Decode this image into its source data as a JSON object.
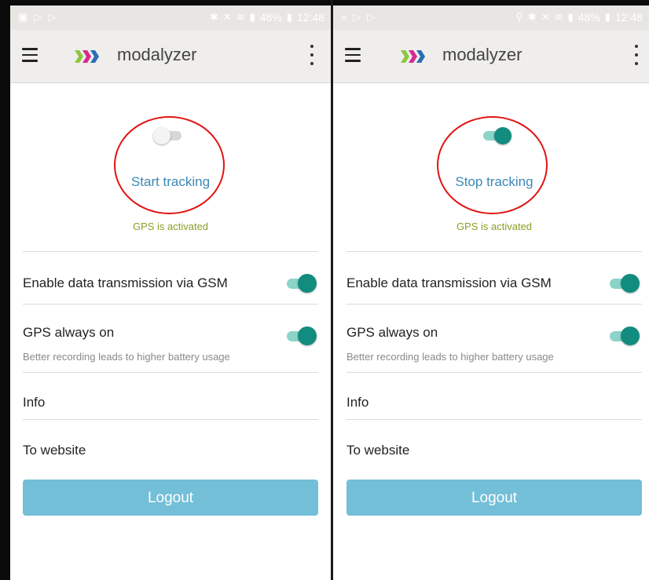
{
  "statusbar": {
    "battery": "48%",
    "time": "12:48"
  },
  "app": {
    "title": "modalyzer"
  },
  "left": {
    "track_button": "Start tracking",
    "gps_status": "GPS is activated",
    "tracking_enabled": false,
    "settings": [
      {
        "label": "Enable data transmission via GSM",
        "enabled": true
      },
      {
        "label": "GPS always on",
        "sub": "Better recording leads to higher battery usage",
        "enabled": true
      }
    ],
    "links": [
      "Info",
      "To website"
    ],
    "logout": "Logout"
  },
  "right": {
    "track_button": "Stop tracking",
    "gps_status": "GPS is activated",
    "tracking_enabled": true,
    "settings": [
      {
        "label": "Enable data transmission via GSM",
        "enabled": true
      },
      {
        "label": "GPS always on",
        "sub": "Better recording leads to higher battery usage",
        "enabled": true
      }
    ],
    "links": [
      "Info",
      "To website"
    ],
    "logout": "Logout"
  },
  "colors": {
    "accent_teal": "#128c7e",
    "link_blue": "#3b88b5",
    "gps_green": "#8aa125",
    "highlight_red": "#e11414",
    "logout_bg": "#73bfd7"
  },
  "icons": [
    "menu-icon",
    "modalyzer-logo-icon",
    "more-vert-icon",
    "toggle-switch-icon"
  ]
}
